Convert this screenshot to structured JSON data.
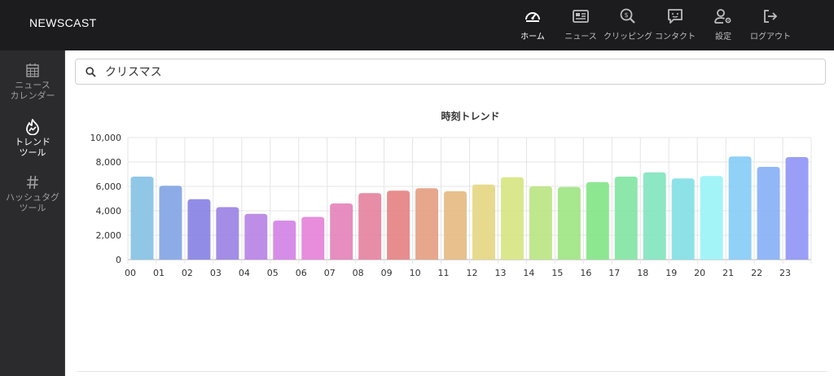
{
  "app": {
    "brand": "NEWSCAST"
  },
  "nav": {
    "items": [
      {
        "label": "ホーム",
        "icon": "dashboard-gauge-icon",
        "active": true
      },
      {
        "label": "ニュース",
        "icon": "newspaper-icon",
        "active": false
      },
      {
        "label": "クリッピング",
        "icon": "search-dollar-icon",
        "active": false
      },
      {
        "label": "コンタクト",
        "icon": "chat-bubble-icon",
        "active": false
      },
      {
        "label": "設定",
        "icon": "user-cog-icon",
        "active": false
      },
      {
        "label": "ログアウト",
        "icon": "logout-icon",
        "active": false
      }
    ]
  },
  "sidebar": {
    "items": [
      {
        "label": "ニュース\nカレンダー",
        "icon": "calendar-icon",
        "active": false
      },
      {
        "label": "トレンド\nツール",
        "icon": "trend-flame-icon",
        "active": true
      },
      {
        "label": "ハッシュタグ\nツール",
        "icon": "hashtag-icon",
        "active": false
      }
    ]
  },
  "search": {
    "value": "クリスマス",
    "icon": "search-icon"
  },
  "chart_data": {
    "type": "bar",
    "title": "時刻トレンド",
    "categories": [
      "00",
      "01",
      "02",
      "03",
      "04",
      "05",
      "06",
      "07",
      "08",
      "09",
      "10",
      "11",
      "12",
      "13",
      "14",
      "15",
      "16",
      "17",
      "18",
      "19",
      "20",
      "21",
      "22",
      "23"
    ],
    "values": [
      6800,
      6050,
      4950,
      4300,
      3750,
      3200,
      3500,
      4600,
      5450,
      5650,
      5850,
      5600,
      6150,
      6750,
      6000,
      5950,
      6350,
      6800,
      7150,
      6650,
      6850,
      8450,
      7600,
      8400
    ],
    "ylim": [
      0,
      10000
    ],
    "yticks": [
      "0",
      "2,000",
      "4,000",
      "6,000",
      "8,000",
      "10,000"
    ],
    "ytick_values": [
      0,
      2000,
      4000,
      6000,
      8000,
      10000
    ],
    "grid": true,
    "legend": "none",
    "colors": [
      "#8ac4e6",
      "#87a8e6",
      "#8b87e6",
      "#9e87e6",
      "#b987e6",
      "#d487e6",
      "#e687da",
      "#e687bd",
      "#e687a2",
      "#e68788",
      "#e6a287",
      "#e6bd87",
      "#e6d887",
      "#d8e687",
      "#bde687",
      "#a2e687",
      "#87e68b",
      "#87e6a6",
      "#87e6c1",
      "#87e0e6",
      "#9ef3f7",
      "#8bcdf7",
      "#8bb3f7",
      "#9599f7"
    ]
  }
}
